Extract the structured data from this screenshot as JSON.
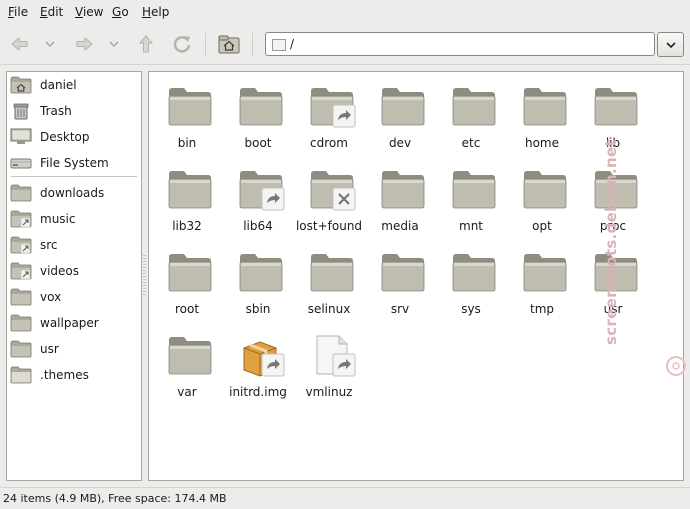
{
  "menu": {
    "items": [
      {
        "pre": "",
        "mn": "F",
        "post": "ile"
      },
      {
        "pre": "",
        "mn": "E",
        "post": "dit"
      },
      {
        "pre": "",
        "mn": "V",
        "post": "iew"
      },
      {
        "pre": "",
        "mn": "G",
        "post": "o"
      },
      {
        "pre": "",
        "mn": "H",
        "post": "elp"
      }
    ]
  },
  "toolbar": {
    "back_icon": "back-arrow",
    "forward_icon": "forward-arrow",
    "up_icon": "up-arrow",
    "reload_icon": "reload",
    "home_icon": "home"
  },
  "location": {
    "path": "/"
  },
  "sidebar": {
    "places": [
      {
        "label": "daniel",
        "icon": "home-folder"
      },
      {
        "label": "Trash",
        "icon": "trash"
      },
      {
        "label": "Desktop",
        "icon": "desktop"
      },
      {
        "label": "File System",
        "icon": "drive"
      }
    ],
    "bookmarks": [
      {
        "label": "downloads",
        "icon": "folder"
      },
      {
        "label": "music",
        "icon": "folder-link"
      },
      {
        "label": "src",
        "icon": "folder-link"
      },
      {
        "label": "videos",
        "icon": "folder-link"
      },
      {
        "label": "vox",
        "icon": "folder"
      },
      {
        "label": "wallpaper",
        "icon": "folder"
      },
      {
        "label": "usr",
        "icon": "folder"
      },
      {
        "label": ".themes",
        "icon": "folder-open"
      }
    ]
  },
  "files": [
    {
      "name": "bin",
      "type": "folder"
    },
    {
      "name": "boot",
      "type": "folder"
    },
    {
      "name": "cdrom",
      "type": "folder-link"
    },
    {
      "name": "dev",
      "type": "folder"
    },
    {
      "name": "etc",
      "type": "folder"
    },
    {
      "name": "home",
      "type": "folder"
    },
    {
      "name": "lib",
      "type": "folder"
    },
    {
      "name": "lib32",
      "type": "folder"
    },
    {
      "name": "lib64",
      "type": "folder-link"
    },
    {
      "name": "lost+found",
      "type": "folder-noaccess"
    },
    {
      "name": "media",
      "type": "folder"
    },
    {
      "name": "mnt",
      "type": "folder"
    },
    {
      "name": "opt",
      "type": "folder"
    },
    {
      "name": "proc",
      "type": "folder"
    },
    {
      "name": "root",
      "type": "folder"
    },
    {
      "name": "sbin",
      "type": "folder"
    },
    {
      "name": "selinux",
      "type": "folder"
    },
    {
      "name": "srv",
      "type": "folder"
    },
    {
      "name": "sys",
      "type": "folder"
    },
    {
      "name": "tmp",
      "type": "folder"
    },
    {
      "name": "usr",
      "type": "folder"
    },
    {
      "name": "var",
      "type": "folder"
    },
    {
      "name": "initrd.img",
      "type": "package-link"
    },
    {
      "name": "vmlinuz",
      "type": "file-link"
    }
  ],
  "status": {
    "text": "24 items (4.9 MB), Free space: 174.4 MB"
  },
  "watermark": {
    "text": "screenshots.debian.net"
  },
  "colors": {
    "folder": "#b9b8a9",
    "folder_dark": "#8e8d80",
    "package": "#e0a040",
    "watermark": "#d9b3b7"
  }
}
